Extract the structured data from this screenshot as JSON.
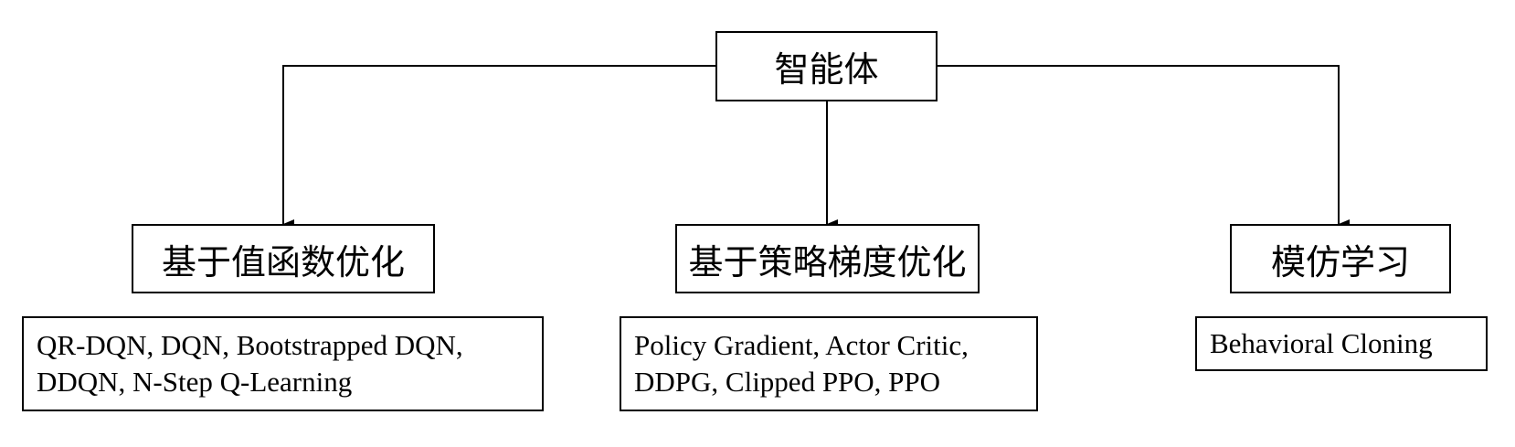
{
  "root": {
    "label": "智能体"
  },
  "categories": [
    {
      "label": "基于值函数优化",
      "algorithms": [
        "QR-DQN, DQN, Bootstrapped DQN,",
        "DDQN, N-Step Q-Learning"
      ]
    },
    {
      "label": "基于策略梯度优化",
      "algorithms": [
        "Policy Gradient, Actor Critic,",
        "DDPG, Clipped PPO, PPO"
      ]
    },
    {
      "label": "模仿学习",
      "algorithms": [
        "Behavioral Cloning"
      ]
    }
  ]
}
